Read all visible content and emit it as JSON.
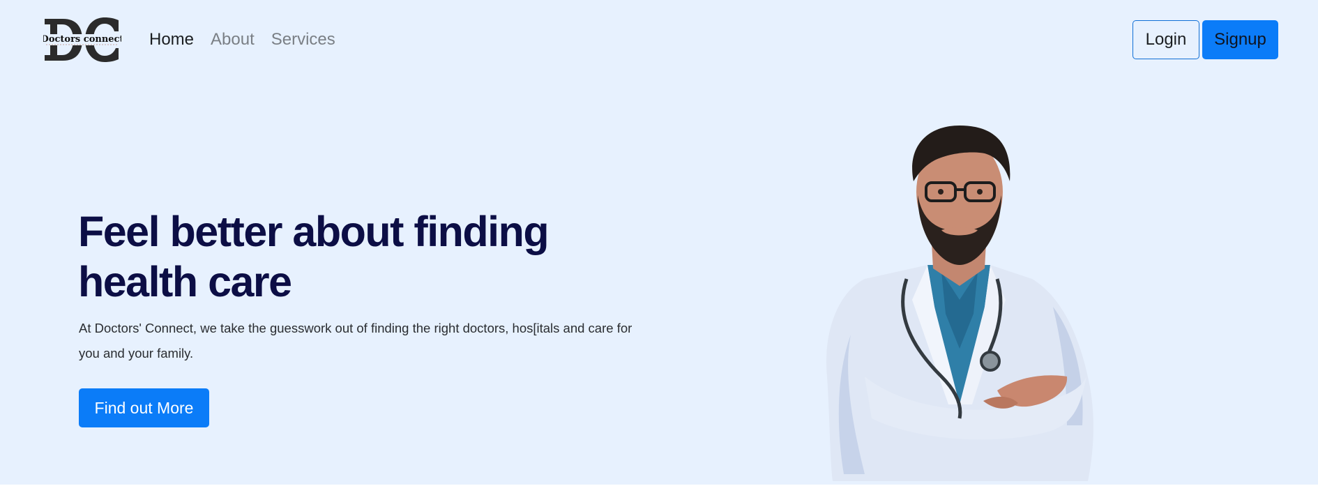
{
  "brand": {
    "logo_letters": "DC",
    "logo_text": "Doctors connect"
  },
  "nav": {
    "items": [
      {
        "label": "Home",
        "active": true
      },
      {
        "label": "About",
        "active": false
      },
      {
        "label": "Services",
        "active": false
      }
    ],
    "login_label": "Login",
    "signup_label": "Signup"
  },
  "hero": {
    "title_line1": "Feel better about finding",
    "title_line2": "health care",
    "description_line1": "At Doctors' Connect, we take the guesswork out of finding the right doctors, hos[itals and care for",
    "description_line2": "you and your family.",
    "cta_label": "Find out More"
  },
  "colors": {
    "background": "#e7f1fe",
    "primary": "#0b7cf8",
    "title": "#0c0e45"
  },
  "icons": {
    "logo": "doctors-connect-logo",
    "hero_image": "doctor-portrait"
  }
}
